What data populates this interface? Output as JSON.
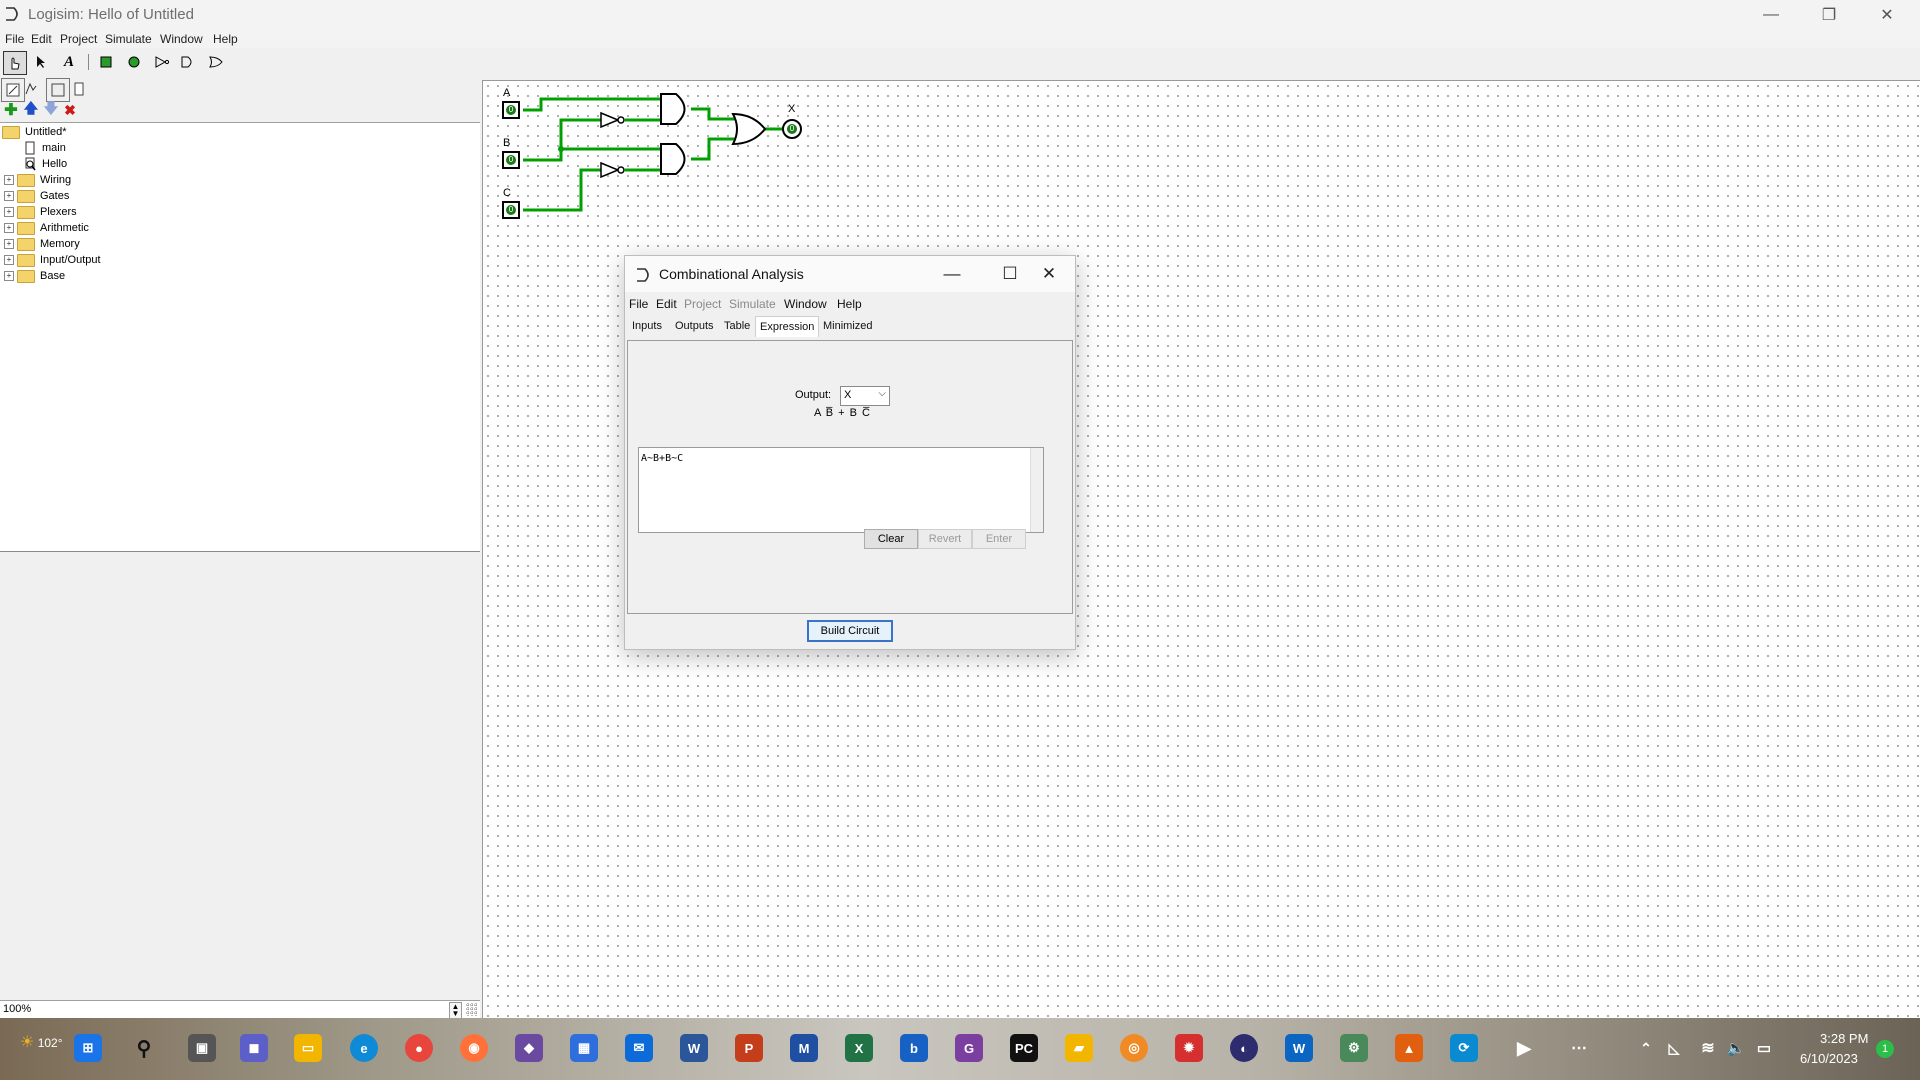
{
  "app": {
    "title": "Logisim: Hello of Untitled",
    "window_controls": [
      "—",
      "❐",
      "✕"
    ]
  },
  "menubar": [
    "File",
    "Edit",
    "Project",
    "Simulate",
    "Window",
    "Help"
  ],
  "explorer": {
    "project": "Untitled*",
    "circuits": [
      "main",
      "Hello"
    ],
    "libraries": [
      "Wiring",
      "Gates",
      "Plexers",
      "Arithmetic",
      "Memory",
      "Input/Output",
      "Base"
    ]
  },
  "zoom": "100%",
  "circuit": {
    "inputs": [
      {
        "label": "A",
        "value": "0"
      },
      {
        "label": "B",
        "value": "0"
      },
      {
        "label": "C",
        "value": "0"
      }
    ],
    "output": {
      "label": "X",
      "value": "0"
    },
    "wire_color": "#00a000"
  },
  "dialog": {
    "title": "Combinational Analysis",
    "controls": [
      "—",
      "☐",
      "✕"
    ],
    "menu": [
      {
        "label": "File",
        "enabled": true
      },
      {
        "label": "Edit",
        "enabled": true
      },
      {
        "label": "Project",
        "enabled": false
      },
      {
        "label": "Simulate",
        "enabled": false
      },
      {
        "label": "Window",
        "enabled": true
      },
      {
        "label": "Help",
        "enabled": true
      }
    ],
    "tabs": [
      "Inputs",
      "Outputs",
      "Table",
      "Expression",
      "Minimized"
    ],
    "active_tab": "Expression",
    "output_label": "Output:",
    "output_selected": "X",
    "expression_display": "A B̅ + B C̅",
    "expression_text": "A~B+B~C",
    "buttons": {
      "clear": "Clear",
      "revert": "Revert",
      "enter": "Enter"
    },
    "build_button": "Build Circuit"
  },
  "taskbar": {
    "weather": "102°",
    "time": "3:28 PM",
    "date": "6/10/2023",
    "notification_count": "1"
  }
}
